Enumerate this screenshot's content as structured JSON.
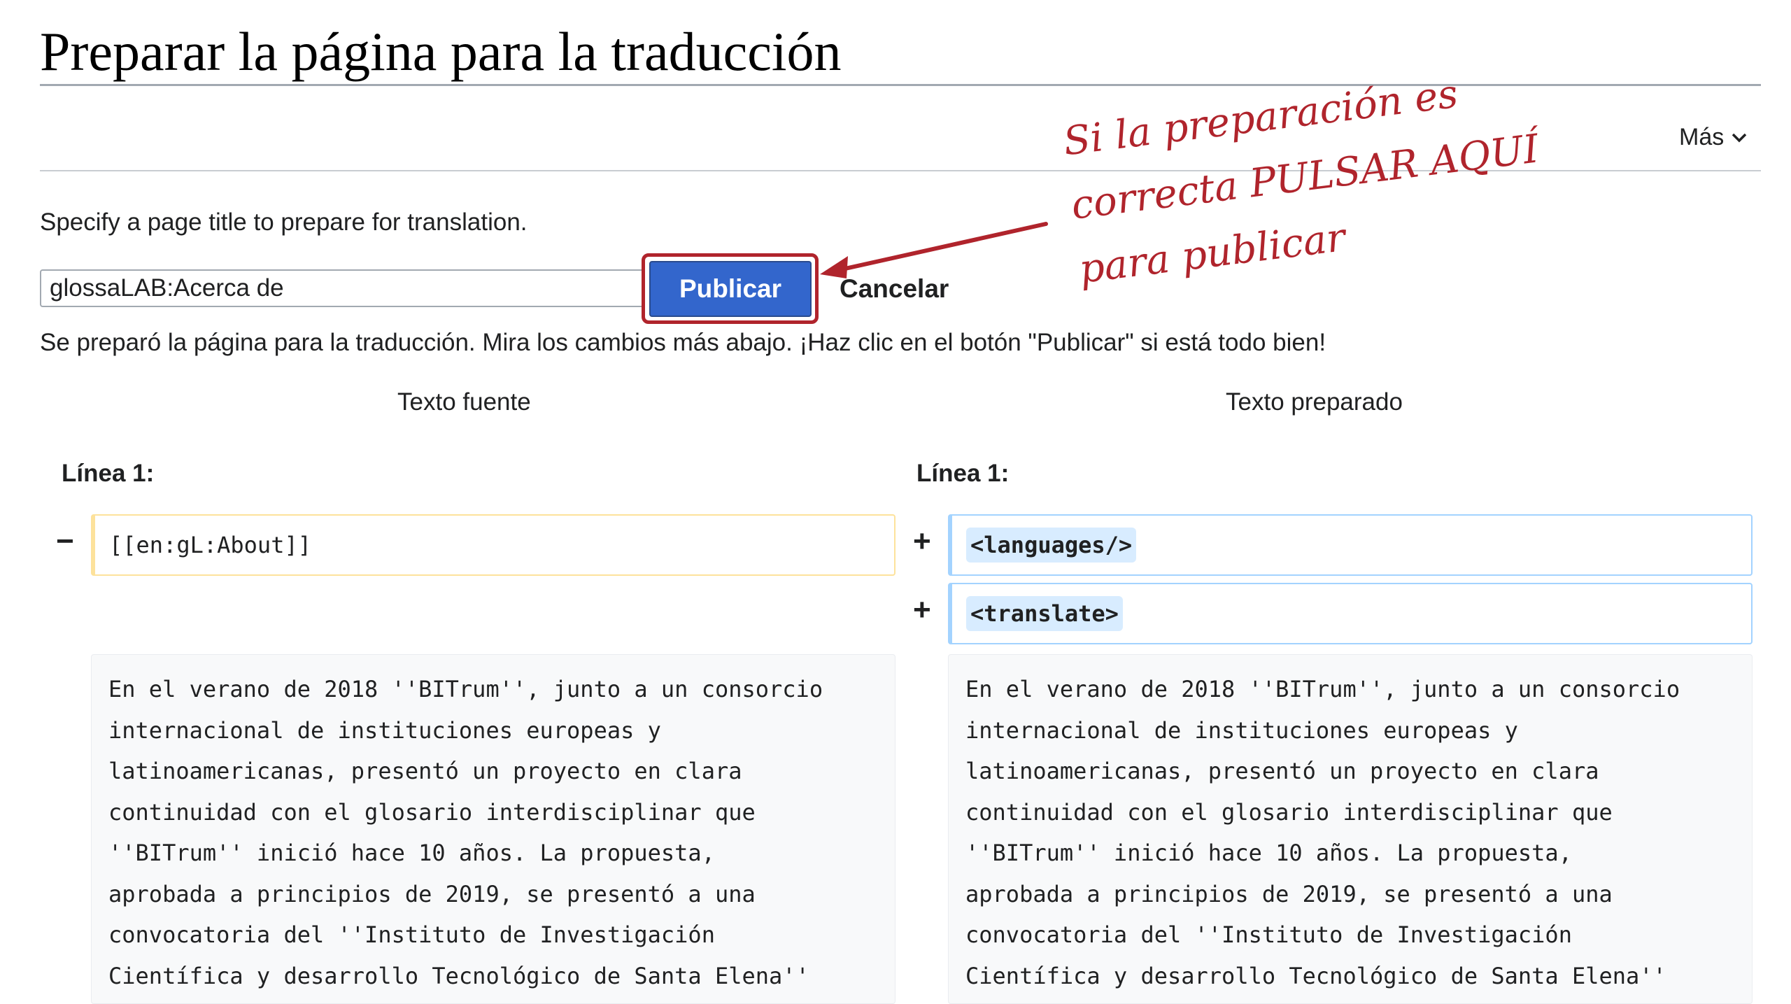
{
  "page": {
    "title": "Preparar la página para la traducción",
    "more_menu_label": "Más"
  },
  "form": {
    "intro_text": "Specify a page title to prepare for translation.",
    "title_input_value": "glossaLAB:Acerca de",
    "publish_label": "Publicar",
    "cancel_label": "Cancelar",
    "status_message": "Se preparó la página para la traducción. Mira los cambios más abajo. ¡Haz clic en el botón \"Publicar\" si está todo bien!"
  },
  "annotation": {
    "lines": [
      "Si la preparación es",
      "correcta PULSAR AQUÍ",
      "para publicar"
    ],
    "color": "#b0242c"
  },
  "diff": {
    "source_header": "Texto fuente",
    "prepared_header": "Texto preparado",
    "source_line_label": "Línea 1:",
    "prepared_line_label": "Línea 1:",
    "deleted_marker": "−",
    "added_marker": "+",
    "deleted_line": "[[en:gL:About]]",
    "added_lines": [
      "<languages/>",
      "<translate>"
    ],
    "context_lines": [
      "En el verano de 2018 ''BITrum'', junto a un consorcio",
      "internacional de instituciones europeas y",
      "latinoamericanas, presentó un proyecto en clara",
      "continuidad con el glosario interdisciplinar que",
      "''BITrum'' inició hace 10 años. La propuesta,",
      "aprobada a principios de 2019, se presentó a una",
      "convocatoria del ''Instituto de Investigación",
      "Científica y desarrollo Tecnológico de Santa Elena''"
    ],
    "colors": {
      "deleted_border": "#fde29b",
      "added_border": "#a3d3ff",
      "added_highlight": "#d8ecff"
    }
  }
}
